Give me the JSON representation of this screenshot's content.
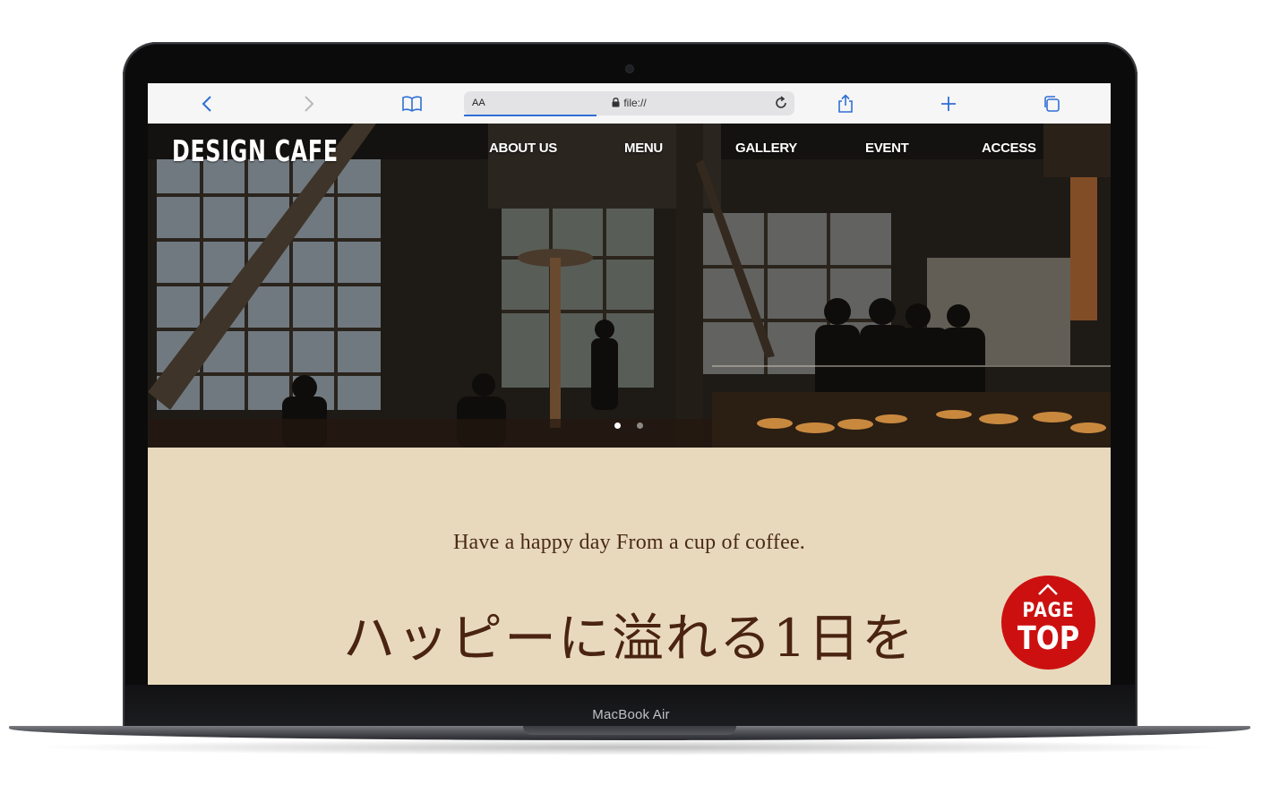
{
  "device": {
    "brand_label": "MacBook Air"
  },
  "browser": {
    "text_size_button": "AA",
    "url": "file://",
    "icons": [
      "back-icon",
      "forward-icon",
      "bookmarks-icon",
      "lock-icon",
      "reload-icon",
      "share-icon",
      "new-tab-icon",
      "tabs-icon"
    ]
  },
  "site": {
    "logo": "DESIGN CAFE",
    "nav": [
      "ABOUT US",
      "MENU",
      "GALLERY",
      "EVENT",
      "ACCESS"
    ],
    "slider": {
      "dots": 2,
      "active_index": 0
    },
    "tagline": "Have a happy day From a cup of coffee.",
    "headline": "ハッピーに溢れる1日を",
    "page_top": {
      "line1": "PAGE",
      "line2": "TOP"
    }
  },
  "colors": {
    "accent_browser": "#2f6fd6",
    "page_background": "#e8d9bd",
    "text_brown": "#4a2410",
    "page_top_red": "#cc1010"
  }
}
